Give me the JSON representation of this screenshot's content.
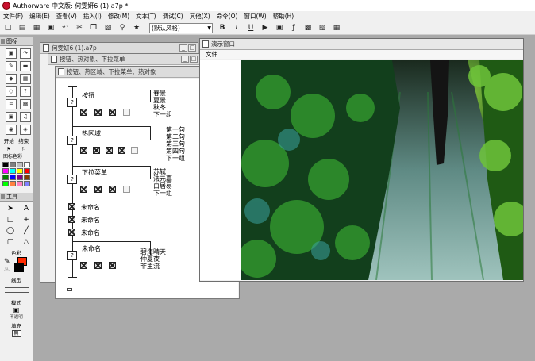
{
  "app": {
    "title": "Authorware 中文版: 何雯妍6 (1).a7p *"
  },
  "menubar": [
    "文件(F)",
    "编辑(E)",
    "查看(V)",
    "插入(I)",
    "修改(M)",
    "文本(T)",
    "调试(C)",
    "其他(X)",
    "命令(O)",
    "窗口(W)",
    "帮助(H)"
  ],
  "toolbar": {
    "style_select": "(默认风格)",
    "bold": "B",
    "italic": "I",
    "underline": "U",
    "icons": [
      "new-icon",
      "open-icon",
      "save-icon",
      "import-icon",
      "undo-icon",
      "cut-icon",
      "copy-icon",
      "paste-icon",
      "find-icon",
      "text-style-icon",
      "run-icon",
      "control-panel-icon",
      "function-icon",
      "variable-icon",
      "knowledge-object-icon"
    ]
  },
  "palette": {
    "header": "图标",
    "icons": [
      "display-icon",
      "motion-icon",
      "erase-icon",
      "wait-icon",
      "navigate-icon",
      "framework-icon",
      "decision-icon",
      "interaction-icon",
      "calculate-icon",
      "map-icon",
      "digital-movie-icon",
      "sound-icon",
      "video-icon",
      "knowledge-object-icon"
    ],
    "start_label": "开始",
    "end_label": "结束",
    "color_label": "图标色彩",
    "swatches": [
      "#000000",
      "#808080",
      "#c0c0c0",
      "#ffffff",
      "#ff00ff",
      "#00ffff",
      "#ffff00",
      "#ff0000",
      "#008000",
      "#0000ff",
      "#800080",
      "#804000",
      "#00ff00",
      "#ff8040",
      "#ff80c0",
      "#8080ff"
    ]
  },
  "tools": {
    "header": "工具",
    "items": [
      "pointer-tool",
      "text-tool",
      "rectangle-tool",
      "cross-tool",
      "oval-tool",
      "line-tool",
      "rounded-rect-tool",
      "polygon-tool"
    ],
    "color_label": "色彩",
    "line_label": "线型",
    "mode_label": "模式",
    "mode_value": "不透明",
    "fill_label": "填充"
  },
  "windows": {
    "back": {
      "title": "何雯妍6 (1).a7p"
    },
    "middle": {
      "title": "按钮、热对象、下拉菜单"
    },
    "front": {
      "title": "按钮、热区域、下拉菜单、热对象"
    }
  },
  "flowline": {
    "groups": [
      {
        "label": "按钮",
        "annotations": [
          "春景",
          "夏景",
          "秋冬",
          "下一组"
        ]
      },
      {
        "label": "热区域",
        "annotations": [
          "第一句",
          "第二句",
          "第三句",
          "第四句",
          "下一组"
        ]
      },
      {
        "label": "下拉菜单",
        "annotations": [
          "苏轼",
          "法元嘉",
          "白居易",
          "下一组"
        ]
      },
      {
        "label": "未命名",
        "annotations": [
          "碧海晴天",
          "仲夏夜",
          "非主流"
        ]
      }
    ],
    "unnamed": [
      "未命名",
      "未命名",
      "未命名"
    ]
  },
  "presentation": {
    "title": "演示窗口",
    "menu_file": "文件"
  }
}
